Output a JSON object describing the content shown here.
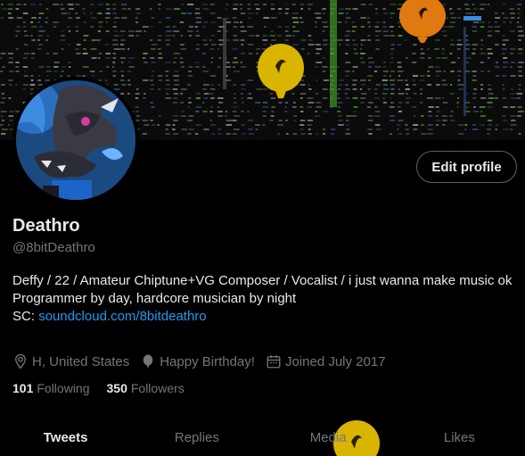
{
  "profile": {
    "name": "Deathro",
    "handle": "@8bitDeathro",
    "edit_label": "Edit profile",
    "bio_line1": "Deffy / 22 / Amateur Chiptune+VG Composer / Vocalist / i just wanna make music ok",
    "bio_line2": "Programmer by day, hardcore musician by night",
    "bio_sc_prefix": "SC: ",
    "bio_link": "soundcloud.com/8bitdeathro",
    "location": "H, United States",
    "birthday": "Happy Birthday!",
    "joined": "Joined July 2017",
    "following_count": "101",
    "following_label": "Following",
    "followers_count": "350",
    "followers_label": "Followers"
  },
  "tabs": [
    {
      "label": "Tweets"
    },
    {
      "label": "Replies"
    },
    {
      "label": "Media"
    },
    {
      "label": "Likes"
    }
  ],
  "colors": {
    "accent": "#1d9bf0",
    "muted": "#71767b",
    "text": "#e7e9ea",
    "balloon_orange": "#e07a10",
    "balloon_yellow": "#d9b400"
  },
  "icons": [
    "location-icon",
    "balloon-icon",
    "calendar-icon"
  ]
}
